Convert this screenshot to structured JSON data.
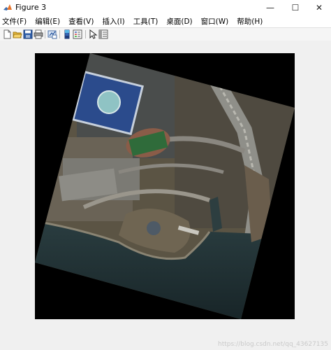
{
  "window": {
    "title": "Figure 3"
  },
  "window_controls": {
    "minimize": "—",
    "maximize": "☐",
    "close": "✕"
  },
  "menu": {
    "items": [
      {
        "label": "文件(F)"
      },
      {
        "label": "编辑(E)"
      },
      {
        "label": "查看(V)"
      },
      {
        "label": "插入(I)"
      },
      {
        "label": "工具(T)"
      },
      {
        "label": "桌面(D)"
      },
      {
        "label": "窗口(W)"
      },
      {
        "label": "帮助(H)"
      }
    ]
  },
  "toolbar": {
    "icons": [
      "new-figure-icon",
      "open-file-icon",
      "save-icon",
      "print-icon",
      "link-plot-icon",
      "insert-colorbar-icon",
      "insert-legend-icon",
      "pointer-icon",
      "property-inspector-icon"
    ]
  },
  "figure": {
    "image_description_none": ""
  },
  "watermark": "https://blog.csdn.net/qq_43627135",
  "colors": {
    "titlebar_bg": "#ffffff",
    "window_bg": "#f0f0f0",
    "axes_bg": "#000000"
  }
}
